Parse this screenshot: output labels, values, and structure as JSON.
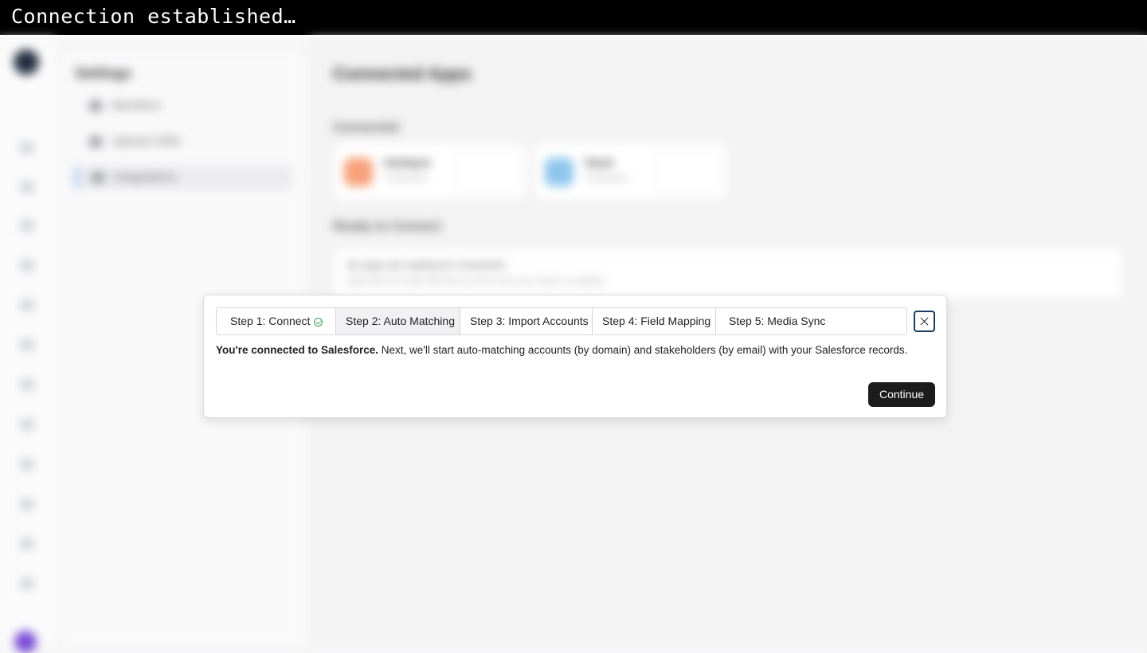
{
  "topbar": {
    "text": "Connection established…"
  },
  "background": {
    "settings_title": "Settings",
    "settings_items": [
      "Members",
      "Upload CRM",
      "Integrations"
    ],
    "main_title": "Connected Apps",
    "connected_label": "Connected",
    "apps": [
      {
        "name": "HubSpot",
        "meta": "Connected",
        "color": "#f7a17a"
      },
      {
        "name": "Slack",
        "meta": "Connected",
        "color": "#8fc6ee"
      }
    ],
    "ready_label": "Ready to Connect",
    "ready_line1": "No apps are waiting for connection",
    "ready_line2": "Apps that are ready will show up here once your setup is complete"
  },
  "modal": {
    "tabs": [
      {
        "label": "Step 1: Connect",
        "completed": true
      },
      {
        "label": "Step 2: Auto Matching",
        "active": true
      },
      {
        "label": "Step 3: Import Accounts"
      },
      {
        "label": "Step 4: Field Mapping"
      },
      {
        "label": "Step 5: Media Sync"
      }
    ],
    "message_bold": "You're connected to Salesforce.",
    "message_rest": " Next, we'll start auto-matching accounts (by domain) and stakeholders (by email) with your Salesforce records.",
    "continue_label": "Continue"
  },
  "colors": {
    "check": "#3aa655",
    "close_border": "#1d3b5e",
    "primary_button": "#1c1c1c"
  }
}
